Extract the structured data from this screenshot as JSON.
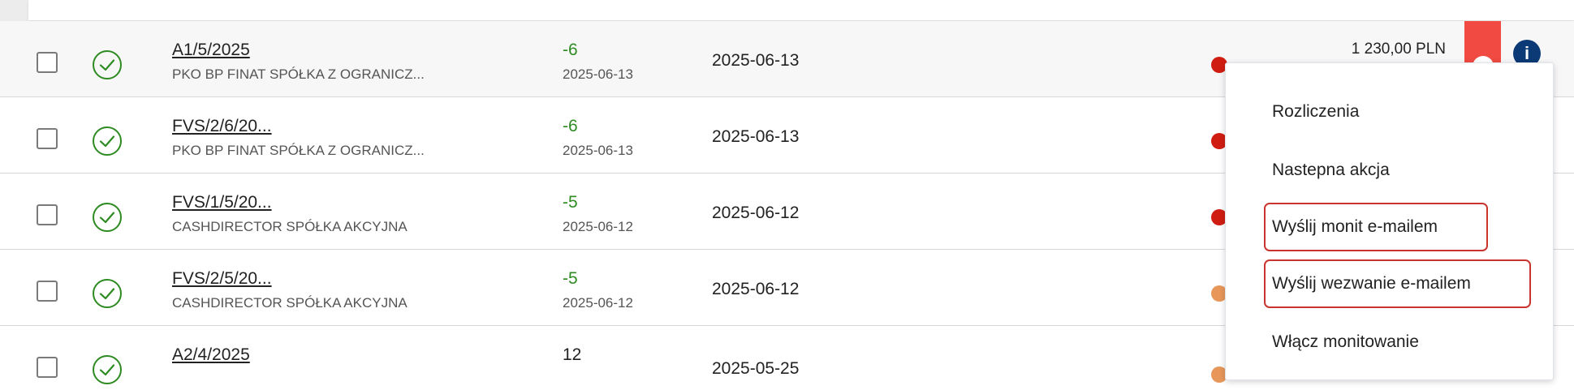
{
  "table": {
    "rows": [
      {
        "doc_number": "A1/5/2025",
        "company": "PKO BP FINAT SPÓŁKA Z OGRANICZ...",
        "days": "-6",
        "due_date": "2025-06-13",
        "date": "2025-06-13",
        "amount": "1 230,00 PLN",
        "status_color": "#d01d12"
      },
      {
        "doc_number": "FVS/2/6/20...",
        "company": "PKO BP FINAT SPÓŁKA Z OGRANICZ...",
        "days": "-6",
        "due_date": "2025-06-13",
        "date": "2025-06-13",
        "amount": "",
        "status_color": "#d01d12"
      },
      {
        "doc_number": "FVS/1/5/20...",
        "company": "CASHDIRECTOR SPÓŁKA AKCYJNA",
        "days": "-5",
        "due_date": "2025-06-12",
        "date": "2025-06-12",
        "amount": "",
        "status_color": "#d01d12"
      },
      {
        "doc_number": "FVS/2/5/20...",
        "company": "CASHDIRECTOR SPÓŁKA AKCYJNA",
        "days": "-5",
        "due_date": "2025-06-12",
        "date": "2025-06-12",
        "amount": "",
        "status_color": "#e8975a"
      },
      {
        "doc_number": "A2/4/2025",
        "company": "",
        "days": "12",
        "due_date": "",
        "date": "2025-05-25",
        "amount": "",
        "status_color": "#e8975a"
      }
    ]
  },
  "menu": {
    "items": [
      {
        "label": "Rozliczenia",
        "highlighted": false
      },
      {
        "label": "Nastepna akcja",
        "highlighted": false
      },
      {
        "label": "Wyślij monit e-mailem",
        "highlighted": true
      },
      {
        "label": "Wyślij wezwanie e-mailem",
        "highlighted": true
      },
      {
        "label": "Włącz monitowanie",
        "highlighted": false
      }
    ]
  },
  "icons": {
    "row_status": "check-circle-icon",
    "info": "info-icon",
    "info_glyph": "i"
  },
  "colors": {
    "check_green": "#2e8b22",
    "negative_days": "#2e8b22",
    "alert_red": "#f04a42",
    "info_blue": "#0b3a76",
    "highlight_red": "#c9352e"
  }
}
